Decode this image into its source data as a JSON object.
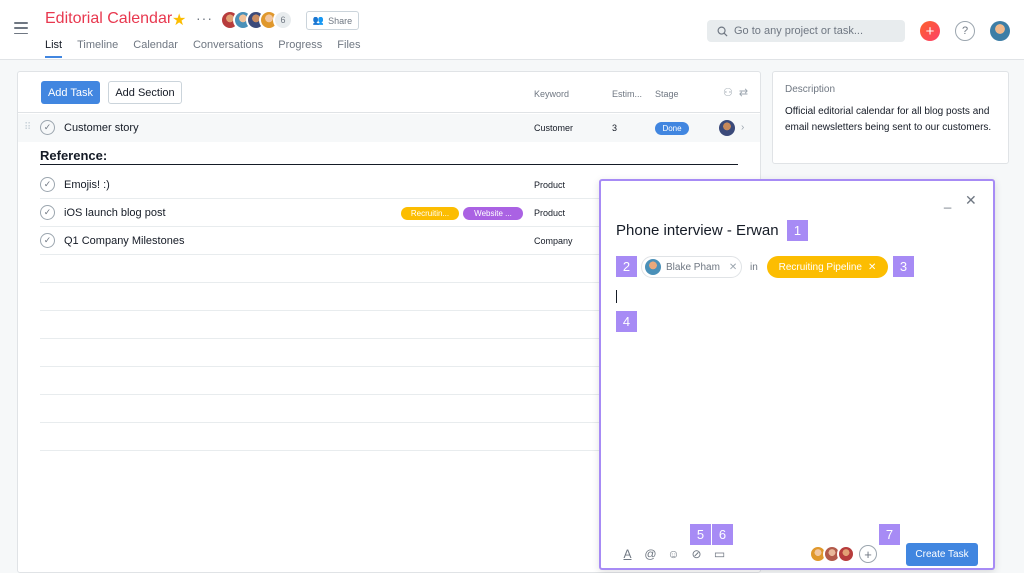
{
  "header": {
    "project_title": "Editorial Calendar",
    "member_count": "6",
    "share_label": "Share",
    "tabs": [
      {
        "label": "List",
        "active": true
      },
      {
        "label": "Timeline",
        "active": false
      },
      {
        "label": "Calendar",
        "active": false
      },
      {
        "label": "Conversations",
        "active": false
      },
      {
        "label": "Progress",
        "active": false
      },
      {
        "label": "Files",
        "active": false
      }
    ],
    "search_placeholder": "Go to any project or task...",
    "help_label": "?",
    "add_label": "+"
  },
  "toolbar": {
    "add_task_label": "Add Task",
    "add_section_label": "Add Section"
  },
  "columns": {
    "keyword": "Keyword",
    "estimate": "Estim...",
    "stage": "Stage"
  },
  "rows": [
    {
      "name": "Customer story",
      "keyword": "Customer",
      "estimate": "3",
      "stage": "Done"
    },
    {
      "name": "Emojis! :)",
      "keyword": "Product"
    },
    {
      "name": "iOS launch blog post",
      "keyword": "Product",
      "tags": [
        "Recruitin...",
        "Website ..."
      ]
    },
    {
      "name": "Q1 Company Milestones",
      "keyword": "Company"
    }
  ],
  "section": {
    "title": "Reference:"
  },
  "description": {
    "title": "Description",
    "body": "Official editorial calendar for all blog posts and email newsletters being sent to our customers."
  },
  "dialog": {
    "title": "Phone interview - Erwan",
    "assignee": "Blake Pham",
    "in_label": "in",
    "project": "Recruiting Pipeline",
    "create_label": "Create Task",
    "badges": [
      "1",
      "2",
      "3",
      "4",
      "5",
      "6",
      "7"
    ]
  },
  "colors": {
    "accent": "#4186e0",
    "title_red": "#e8384f",
    "project_yellow": "#fcbd01",
    "tag_purple": "#aa62e3",
    "badge_purple": "#a78bf5"
  }
}
